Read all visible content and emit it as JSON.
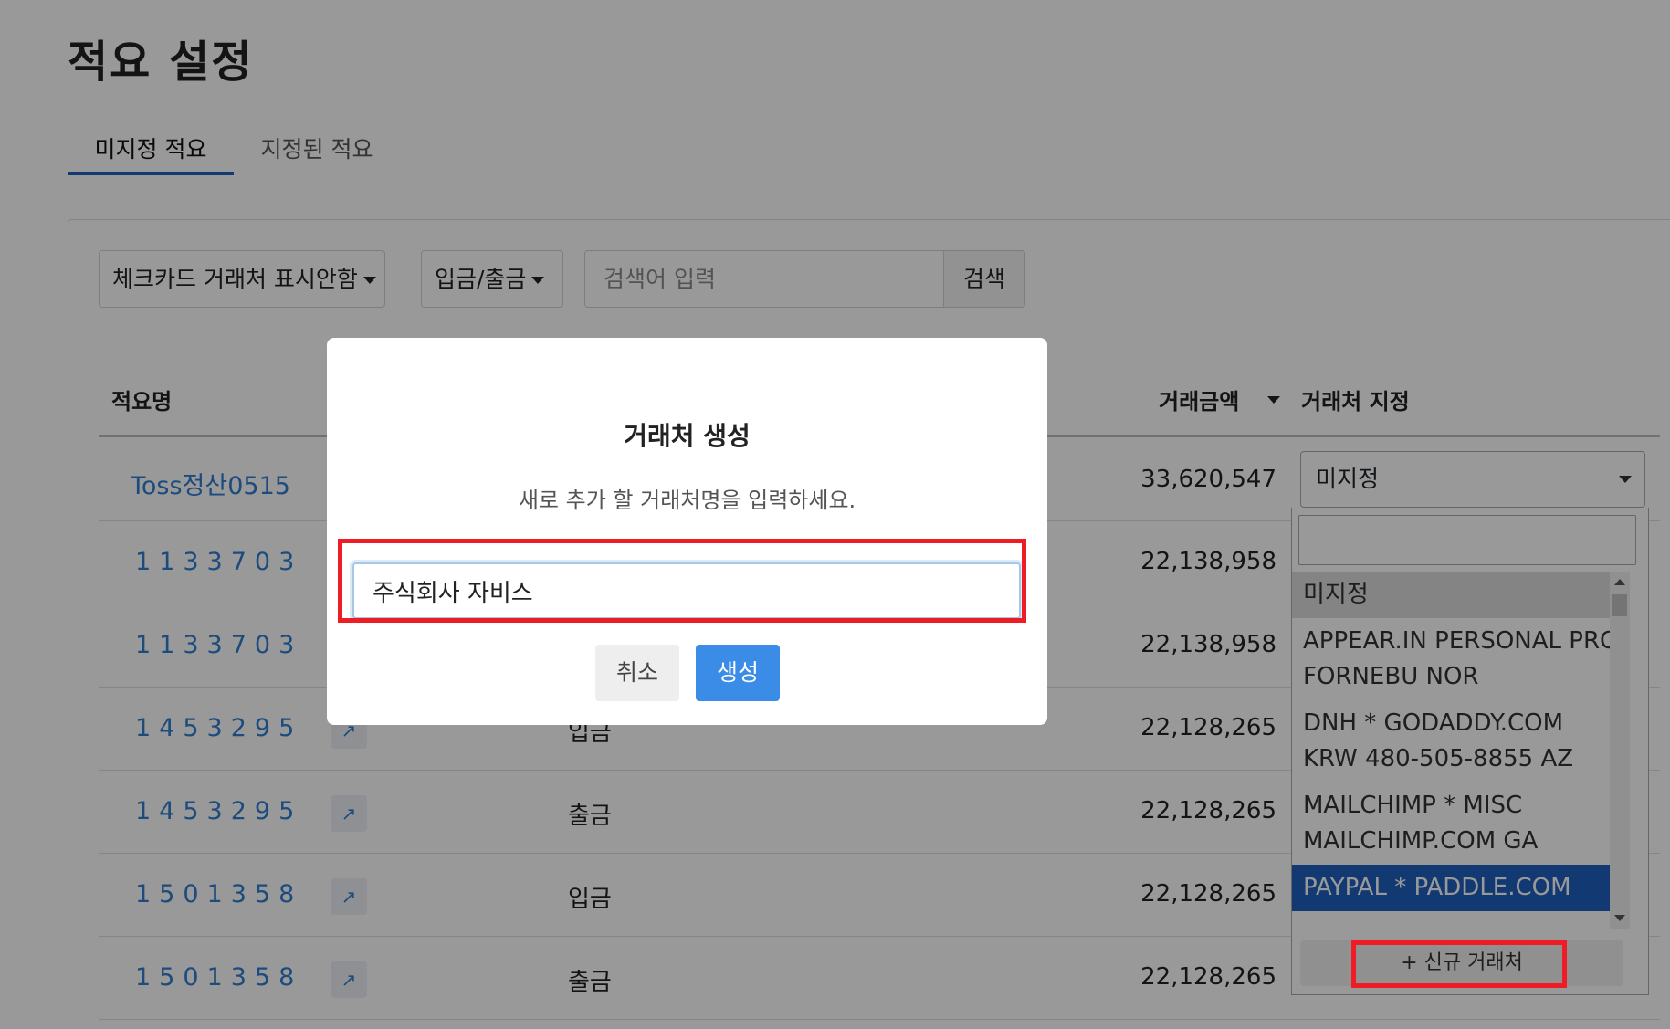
{
  "page": {
    "title": "적요 설정"
  },
  "tabs": [
    {
      "label": "미지정 적요",
      "active": true
    },
    {
      "label": "지정된 적요",
      "active": false
    }
  ],
  "filters": {
    "checkcard_label": "체크카드 거래처 표시안함",
    "inout_label": "입금/출금",
    "search_placeholder": "검색어 입력",
    "search_button": "검색"
  },
  "table": {
    "headers": {
      "name": "적요명",
      "amount": "거래금액",
      "vendor": "거래처 지정"
    },
    "rows": [
      {
        "name": "Toss정산0515",
        "type": "",
        "amount": "33,620,547"
      },
      {
        "name": "1133703",
        "type": "",
        "amount": "22,138,958"
      },
      {
        "name": "1133703",
        "type": "",
        "amount": "22,138,958"
      },
      {
        "name": "1453295",
        "type": "입금",
        "amount": "22,128,265"
      },
      {
        "name": "1453295",
        "type": "출금",
        "amount": "22,128,265"
      },
      {
        "name": "1501358",
        "type": "입금",
        "amount": "22,128,265"
      },
      {
        "name": "1501358",
        "type": "출금",
        "amount": "22,128,265"
      }
    ]
  },
  "vendor_select": {
    "selected": "미지정",
    "options": [
      "미지정",
      "APPEAR.IN PERSONAL PRO FORNEBU NOR",
      "DNH * GODADDY.COM KRW 480-505-8855 AZ",
      "MAILCHIMP  * MISC MAILCHIMP.COM GA",
      "PAYPAL  * PADDLE.COM"
    ],
    "new_vendor_button": "+ 신규 거래처"
  },
  "modal": {
    "title": "거래처 생성",
    "subtitle": "새로 추가 할 거래처명을 입력하세요.",
    "input_value": "주식회사 자비스",
    "cancel_label": "취소",
    "create_label": "생성"
  },
  "colors": {
    "accent": "#1f5fbf",
    "link": "#2f7dd1",
    "primary_button": "#3a8ce6",
    "highlight_box": "#ee1c25"
  }
}
